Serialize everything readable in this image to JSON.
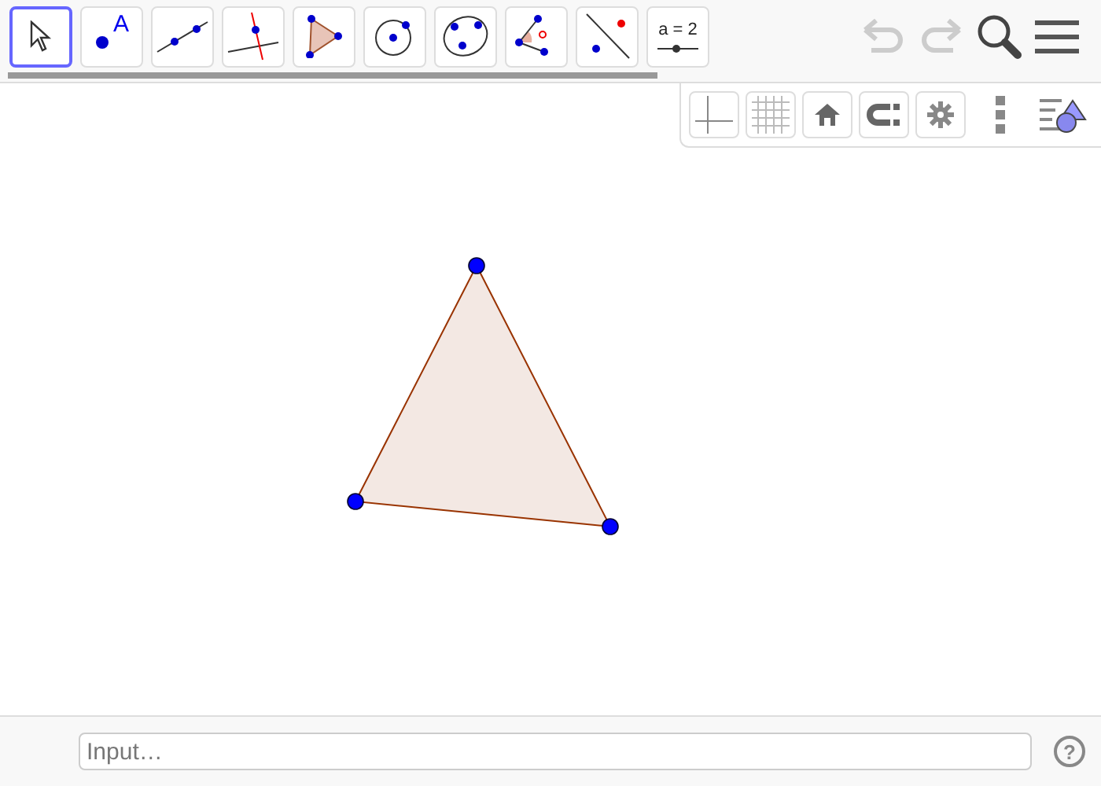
{
  "toolbar": {
    "tools": [
      {
        "kind": "move",
        "selected": true
      },
      {
        "kind": "point",
        "selected": false,
        "label": "A"
      },
      {
        "kind": "line",
        "selected": false
      },
      {
        "kind": "perpendicular",
        "selected": false
      },
      {
        "kind": "polygon",
        "selected": false
      },
      {
        "kind": "circle",
        "selected": false
      },
      {
        "kind": "conic",
        "selected": false
      },
      {
        "kind": "angle",
        "selected": false
      },
      {
        "kind": "reflect",
        "selected": false
      },
      {
        "kind": "slider",
        "selected": false,
        "label": "a = 2"
      }
    ],
    "undo": {
      "disabled": true
    },
    "redo": {
      "disabled": true
    }
  },
  "style_bar": {
    "buttons": [
      {
        "kind": "axes"
      },
      {
        "kind": "grid"
      },
      {
        "kind": "home"
      },
      {
        "kind": "magnet"
      },
      {
        "kind": "gear"
      },
      {
        "kind": "more"
      },
      {
        "kind": "views"
      }
    ]
  },
  "input_bar": {
    "placeholder": "Input…",
    "help": "?"
  }
}
